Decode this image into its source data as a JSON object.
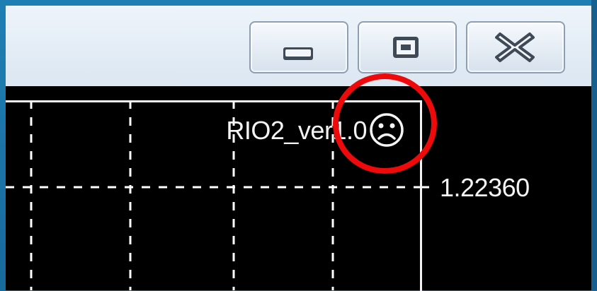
{
  "window": {
    "caption_buttons": {
      "minimize_icon": "minimize-icon",
      "maximize_icon": "maximize-icon",
      "close_icon": "close-icon"
    }
  },
  "chart": {
    "indicator_name": "RIO2_ver1.0",
    "status_icon": "sad-face-icon",
    "price_level": "1.22360"
  },
  "colors": {
    "frame_blue": "#1a6ea0",
    "chart_background": "#000000",
    "grid_line": "#ffffff",
    "highlight": "#ee0a0a"
  }
}
